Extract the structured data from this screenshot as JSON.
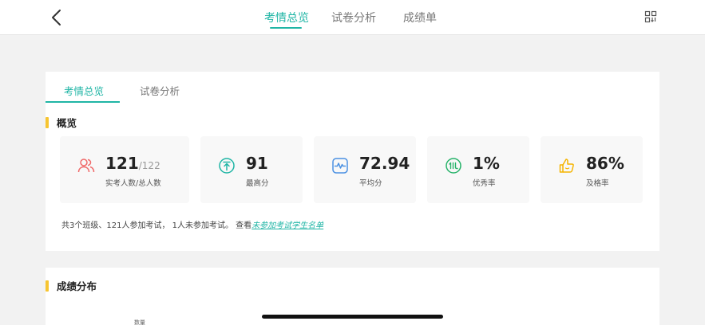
{
  "header": {
    "tabs": [
      {
        "label": "考情总览",
        "active": true
      },
      {
        "label": "试卷分析",
        "active": false
      },
      {
        "label": "成绩单",
        "active": false
      }
    ],
    "back_icon": "chevron-left-icon",
    "scan_icon": "scan-icon"
  },
  "inner_tabs": [
    {
      "label": "考情总览",
      "active": true
    },
    {
      "label": "试卷分析",
      "active": false
    }
  ],
  "overview": {
    "title": "概览",
    "stats": [
      {
        "value": "121",
        "total": "/122",
        "label": "实考人数/总人数",
        "icon": "people-icon",
        "color": "#f06a6a"
      },
      {
        "value": "91",
        "label": "最高分",
        "icon": "arrow-up-circle-icon",
        "color": "#1fb5a5"
      },
      {
        "value": "72.94",
        "label": "平均分",
        "icon": "pulse-icon",
        "color": "#4a90e2"
      },
      {
        "value": "1%",
        "label": "优秀率",
        "icon": "excellent-badge-icon",
        "color": "#27b36a"
      },
      {
        "value": "86%",
        "label": "及格率",
        "icon": "thumbs-up-icon",
        "color": "#f5b400"
      }
    ],
    "summary_text": "共3个班级、121人参加考试， 1人未参加考试。 查看",
    "summary_link": "未参加考试学生名单"
  },
  "distribution": {
    "title": "成绩分布",
    "y_axis_label": "数量"
  },
  "colors": {
    "accent": "#1fb5a5",
    "section_bar": "#f7c531"
  }
}
